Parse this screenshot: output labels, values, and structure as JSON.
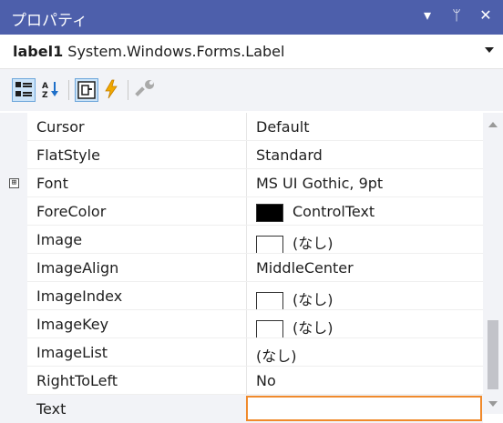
{
  "window": {
    "title": "プロパティ",
    "buttons": [
      "▾",
      "ᛘ",
      "✕"
    ]
  },
  "object_selector": {
    "name": "label1",
    "type": "System.Windows.Forms.Label"
  },
  "toolbar": {
    "icons": [
      "categorized-icon",
      "alphabetical-icon",
      "properties-icon",
      "events-icon",
      "property-pages-icon"
    ]
  },
  "properties": [
    {
      "name": "Cursor",
      "value": "Default"
    },
    {
      "name": "FlatStyle",
      "value": "Standard"
    },
    {
      "name": "Font",
      "value": "MS UI Gothic, 9pt",
      "expander": "⊞"
    },
    {
      "name": "ForeColor",
      "value": "ControlText",
      "swatch": "#000000"
    },
    {
      "name": "Image",
      "value": "(なし)",
      "swatch": "#ffffff"
    },
    {
      "name": "ImageAlign",
      "value": "MiddleCenter"
    },
    {
      "name": "ImageIndex",
      "value": "(なし)",
      "swatch": "#ffffff"
    },
    {
      "name": "ImageKey",
      "value": "(なし)",
      "swatch": "#ffffff"
    },
    {
      "name": "ImageList",
      "value": "(なし)"
    },
    {
      "name": "RightToLeft",
      "value": "No"
    },
    {
      "name": "Text",
      "value": ""
    }
  ],
  "colors": {
    "title_bar": "#4d5fab",
    "edit_border": "#f08a2c",
    "selected_tool": "#cbe3f8"
  }
}
